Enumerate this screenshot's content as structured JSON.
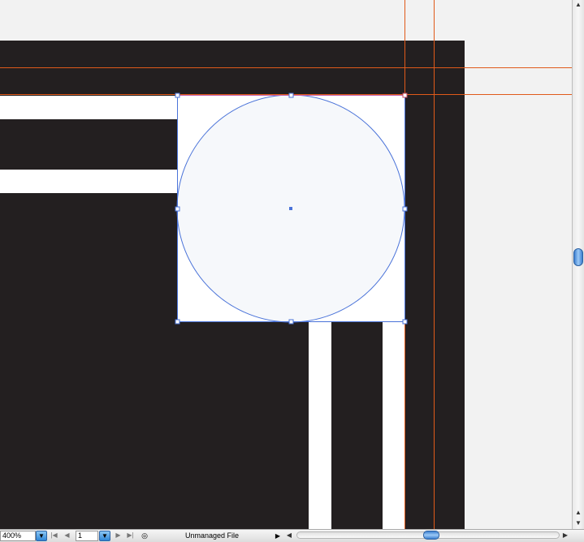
{
  "status_bar": {
    "zoom_value": "400%",
    "zoom_dropdown_icon": "chevron-down-icon",
    "page_value": "1",
    "first_page_icon": "first-page-icon",
    "prev_page_icon": "previous-page-icon",
    "next_page_icon": "next-page-icon",
    "last_page_icon": "last-page-icon",
    "file_status": "Unmanaged File",
    "status_menu_icon": "triangle-right-icon"
  },
  "colors": {
    "artboard": "#231f20",
    "stripe": "#ffffff",
    "guide": "#e05a1a",
    "selection": "#4a73d9",
    "circle_fill": "#f6f8fb",
    "pasteboard": "#f2f2f2"
  }
}
